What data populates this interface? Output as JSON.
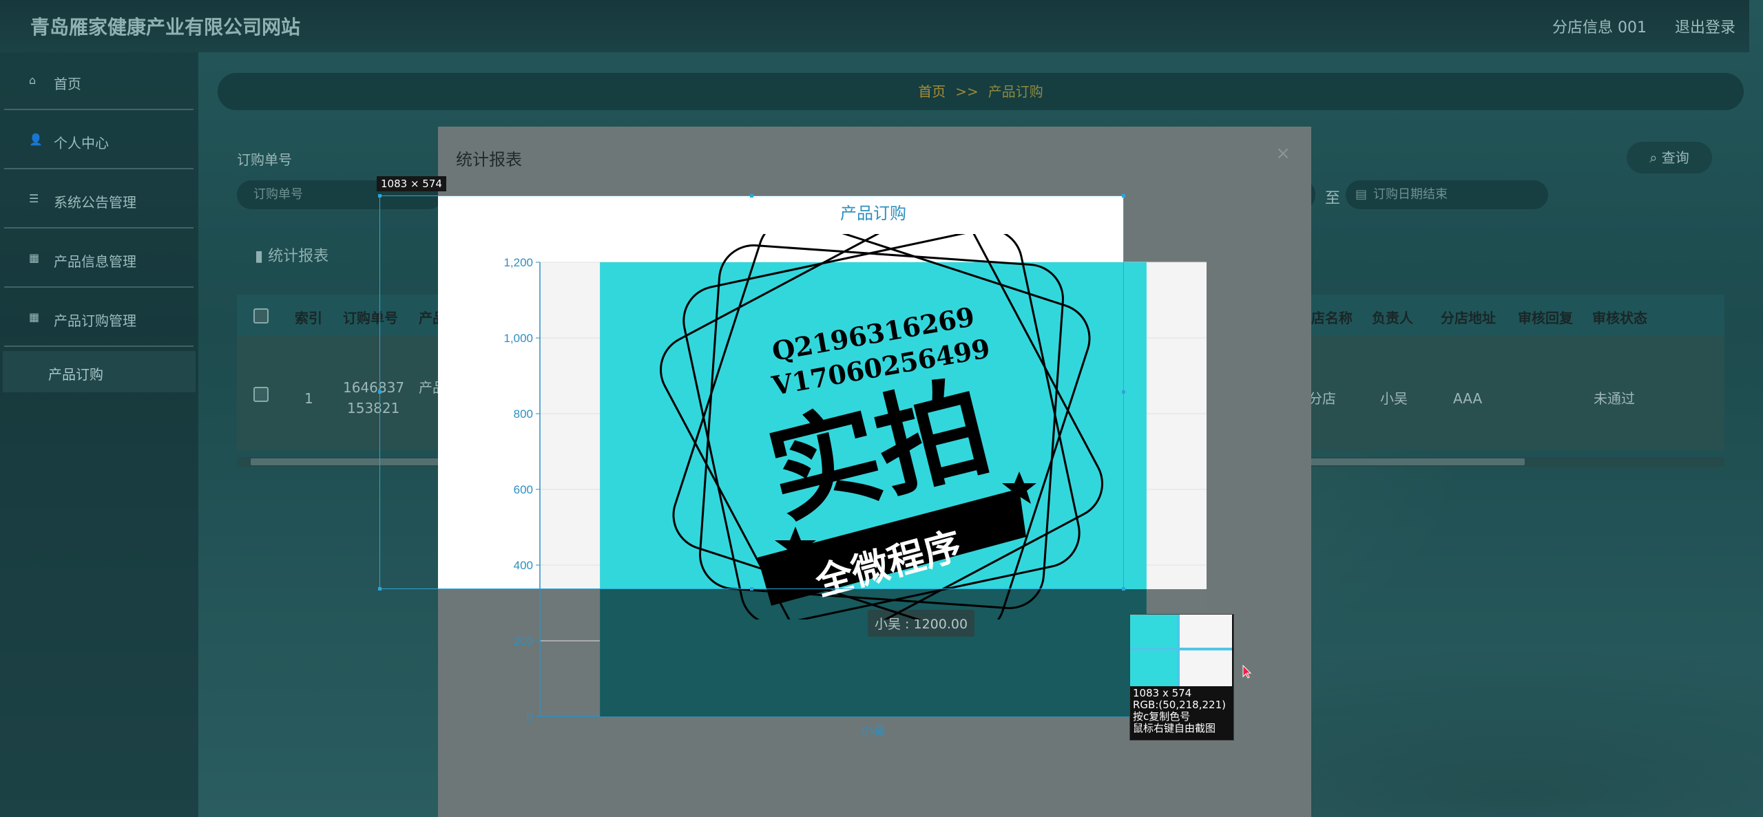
{
  "app": {
    "title": "青岛雁家健康产业有限公司网站"
  },
  "header": {
    "user_label": "分店信息 001",
    "logout_label": "退出登录"
  },
  "sidebar": {
    "items": [
      {
        "label": "首页",
        "icon": "home-icon"
      },
      {
        "label": "个人中心",
        "icon": "user-icon"
      },
      {
        "label": "系统公告管理",
        "icon": "list-icon"
      },
      {
        "label": "产品信息管理",
        "icon": "grid-icon"
      },
      {
        "label": "产品订购管理",
        "icon": "grid-icon"
      }
    ],
    "sub_active": "产品订购"
  },
  "breadcrumb": {
    "home": "首页",
    "sep": ">>",
    "current": "产品订购"
  },
  "filters": {
    "order_label": "订购单号",
    "order_placeholder": "订购单号",
    "to_label": "至",
    "date_end_placeholder": "订购日期结束",
    "search_label": "查询"
  },
  "stat_tab_label": "统计报表",
  "table": {
    "columns": [
      "索引",
      "订购单号",
      "产品",
      "店名称",
      "负责人",
      "分店地址",
      "审核回复",
      "审核状态"
    ],
    "row": {
      "index": "1",
      "order_no_line1": "1646837",
      "order_no_line2": "153821",
      "product": "产品",
      "store": "分店",
      "manager": "小吴",
      "address": "AAA",
      "reply": "",
      "status": "未通过"
    }
  },
  "modal": {
    "title": "统计报表",
    "close": "×"
  },
  "chart_data": {
    "type": "bar",
    "title": "产品订购",
    "categories": [
      "小吴"
    ],
    "values": [
      1200
    ],
    "ylim": [
      0,
      1200
    ],
    "yticks": [
      0,
      200,
      400,
      600,
      800,
      1000,
      1200
    ],
    "ytick_labels": [
      "0",
      "200",
      "400",
      "600",
      "800",
      "1,000",
      "1,200"
    ],
    "tooltip": "小吴 : 1200.00",
    "bar_color": "#32d7dc"
  },
  "screenshot_tool": {
    "selection_size": "1083 × 574",
    "info_lines": [
      "1083 x 574",
      "RGB:(50,218,221)",
      "按c复制色号",
      "鼠标右键自由截图"
    ]
  },
  "watermark": {
    "line1": "Q2196316269",
    "line2": "V17060256499",
    "big": "实拍",
    "banner": "全微程序"
  }
}
